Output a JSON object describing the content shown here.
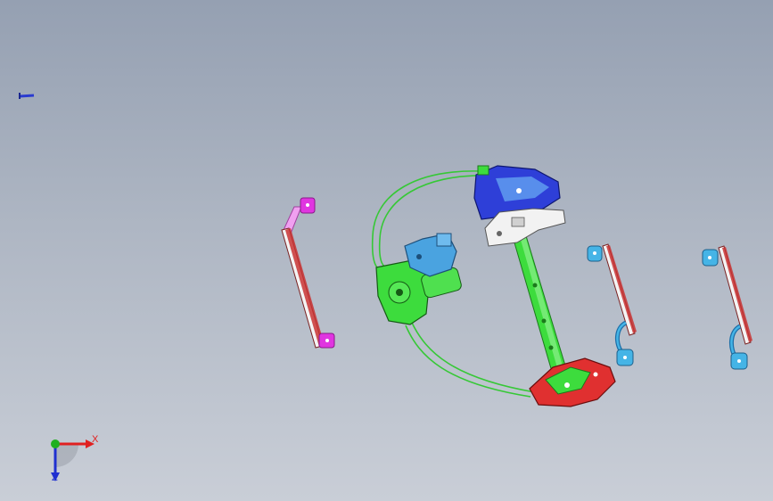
{
  "viewport": {
    "background_top": "#95a0b2",
    "background_bottom": "#c9ced7"
  },
  "colors": {
    "motor_green": "#3ddc3d",
    "cable_green": "#36c836",
    "motor_blue": "#4aa3e0",
    "upper_slider_blue": "#2e3fd8",
    "upper_bracket_white": "#f2f2f2",
    "lower_slider_red": "#e03030",
    "left_rail_red": "#c83232",
    "left_rail_tab": "#e035e0",
    "right_rail_tab": "#45b4e6",
    "axis_x": "#e02020",
    "axis_y": "#20b020",
    "axis_z": "#2030d0"
  },
  "parts": [
    {
      "name": "screw",
      "icon": "screw-icon"
    },
    {
      "name": "left-guide-rail",
      "icon": "guide-rail-icon"
    },
    {
      "name": "cable-loop",
      "icon": "cable-icon"
    },
    {
      "name": "window-motor",
      "icon": "motor-icon"
    },
    {
      "name": "center-rail",
      "icon": "rail-icon"
    },
    {
      "name": "upper-slider",
      "icon": "slider-icon"
    },
    {
      "name": "lower-slider",
      "icon": "slider-icon"
    },
    {
      "name": "right-guide-rail-1",
      "icon": "guide-rail-icon"
    },
    {
      "name": "right-guide-rail-2",
      "icon": "guide-rail-icon"
    }
  ],
  "triad": {
    "x_label": "X",
    "z_label": "Z"
  }
}
